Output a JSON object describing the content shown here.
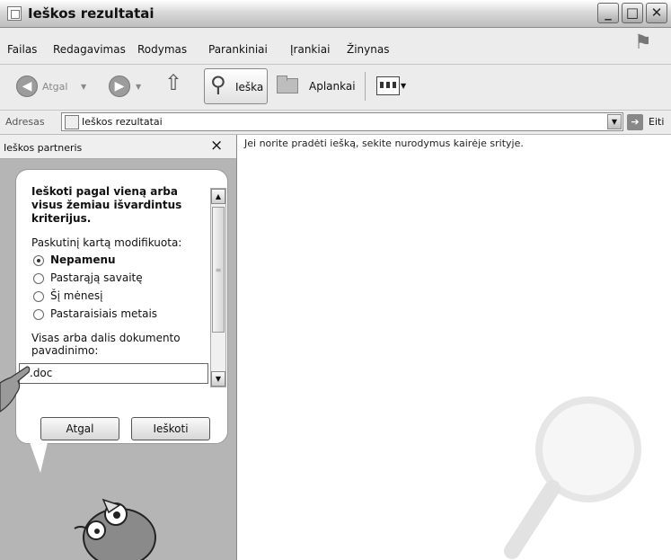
{
  "window": {
    "title": "Ieškos rezultatai"
  },
  "menu": [
    "Failas",
    "Redagavimas",
    "Rodymas",
    "Parankiniai",
    "Įrankiai",
    "Žinynas"
  ],
  "toolbar": {
    "back_label": "Atgal",
    "search_label": "Ieška",
    "folders_label": "Aplankai"
  },
  "address": {
    "label": "Adresas",
    "value": "Ieškos rezultatai",
    "go_label": "Eiti"
  },
  "search_panel": {
    "title": "Ieškos partneris",
    "close": "×",
    "heading": "Ieškoti pagal vieną arba visus žemiau išvardintus kriterijus.",
    "modified_label": "Paskutinį kartą modifikuota:",
    "options": [
      "Nepamenu",
      "Pastarąją savaitę",
      "Šį mėnesį",
      "Pastaraisiais metais"
    ],
    "selected_option": "Nepamenu",
    "filename_label": "Visas arba dalis dokumento pavadinimo:",
    "filename_value": "*.doc",
    "back_button": "Atgal",
    "search_button": "Ieškoti"
  },
  "main": {
    "message": "Jei norite pradėti iešką, sekite nurodymus kairėje srityje."
  },
  "colors": {
    "panel_bg": "#b5b5b5",
    "bubble_bg": "#ffffff",
    "toolbar_bg": "#ececec"
  }
}
